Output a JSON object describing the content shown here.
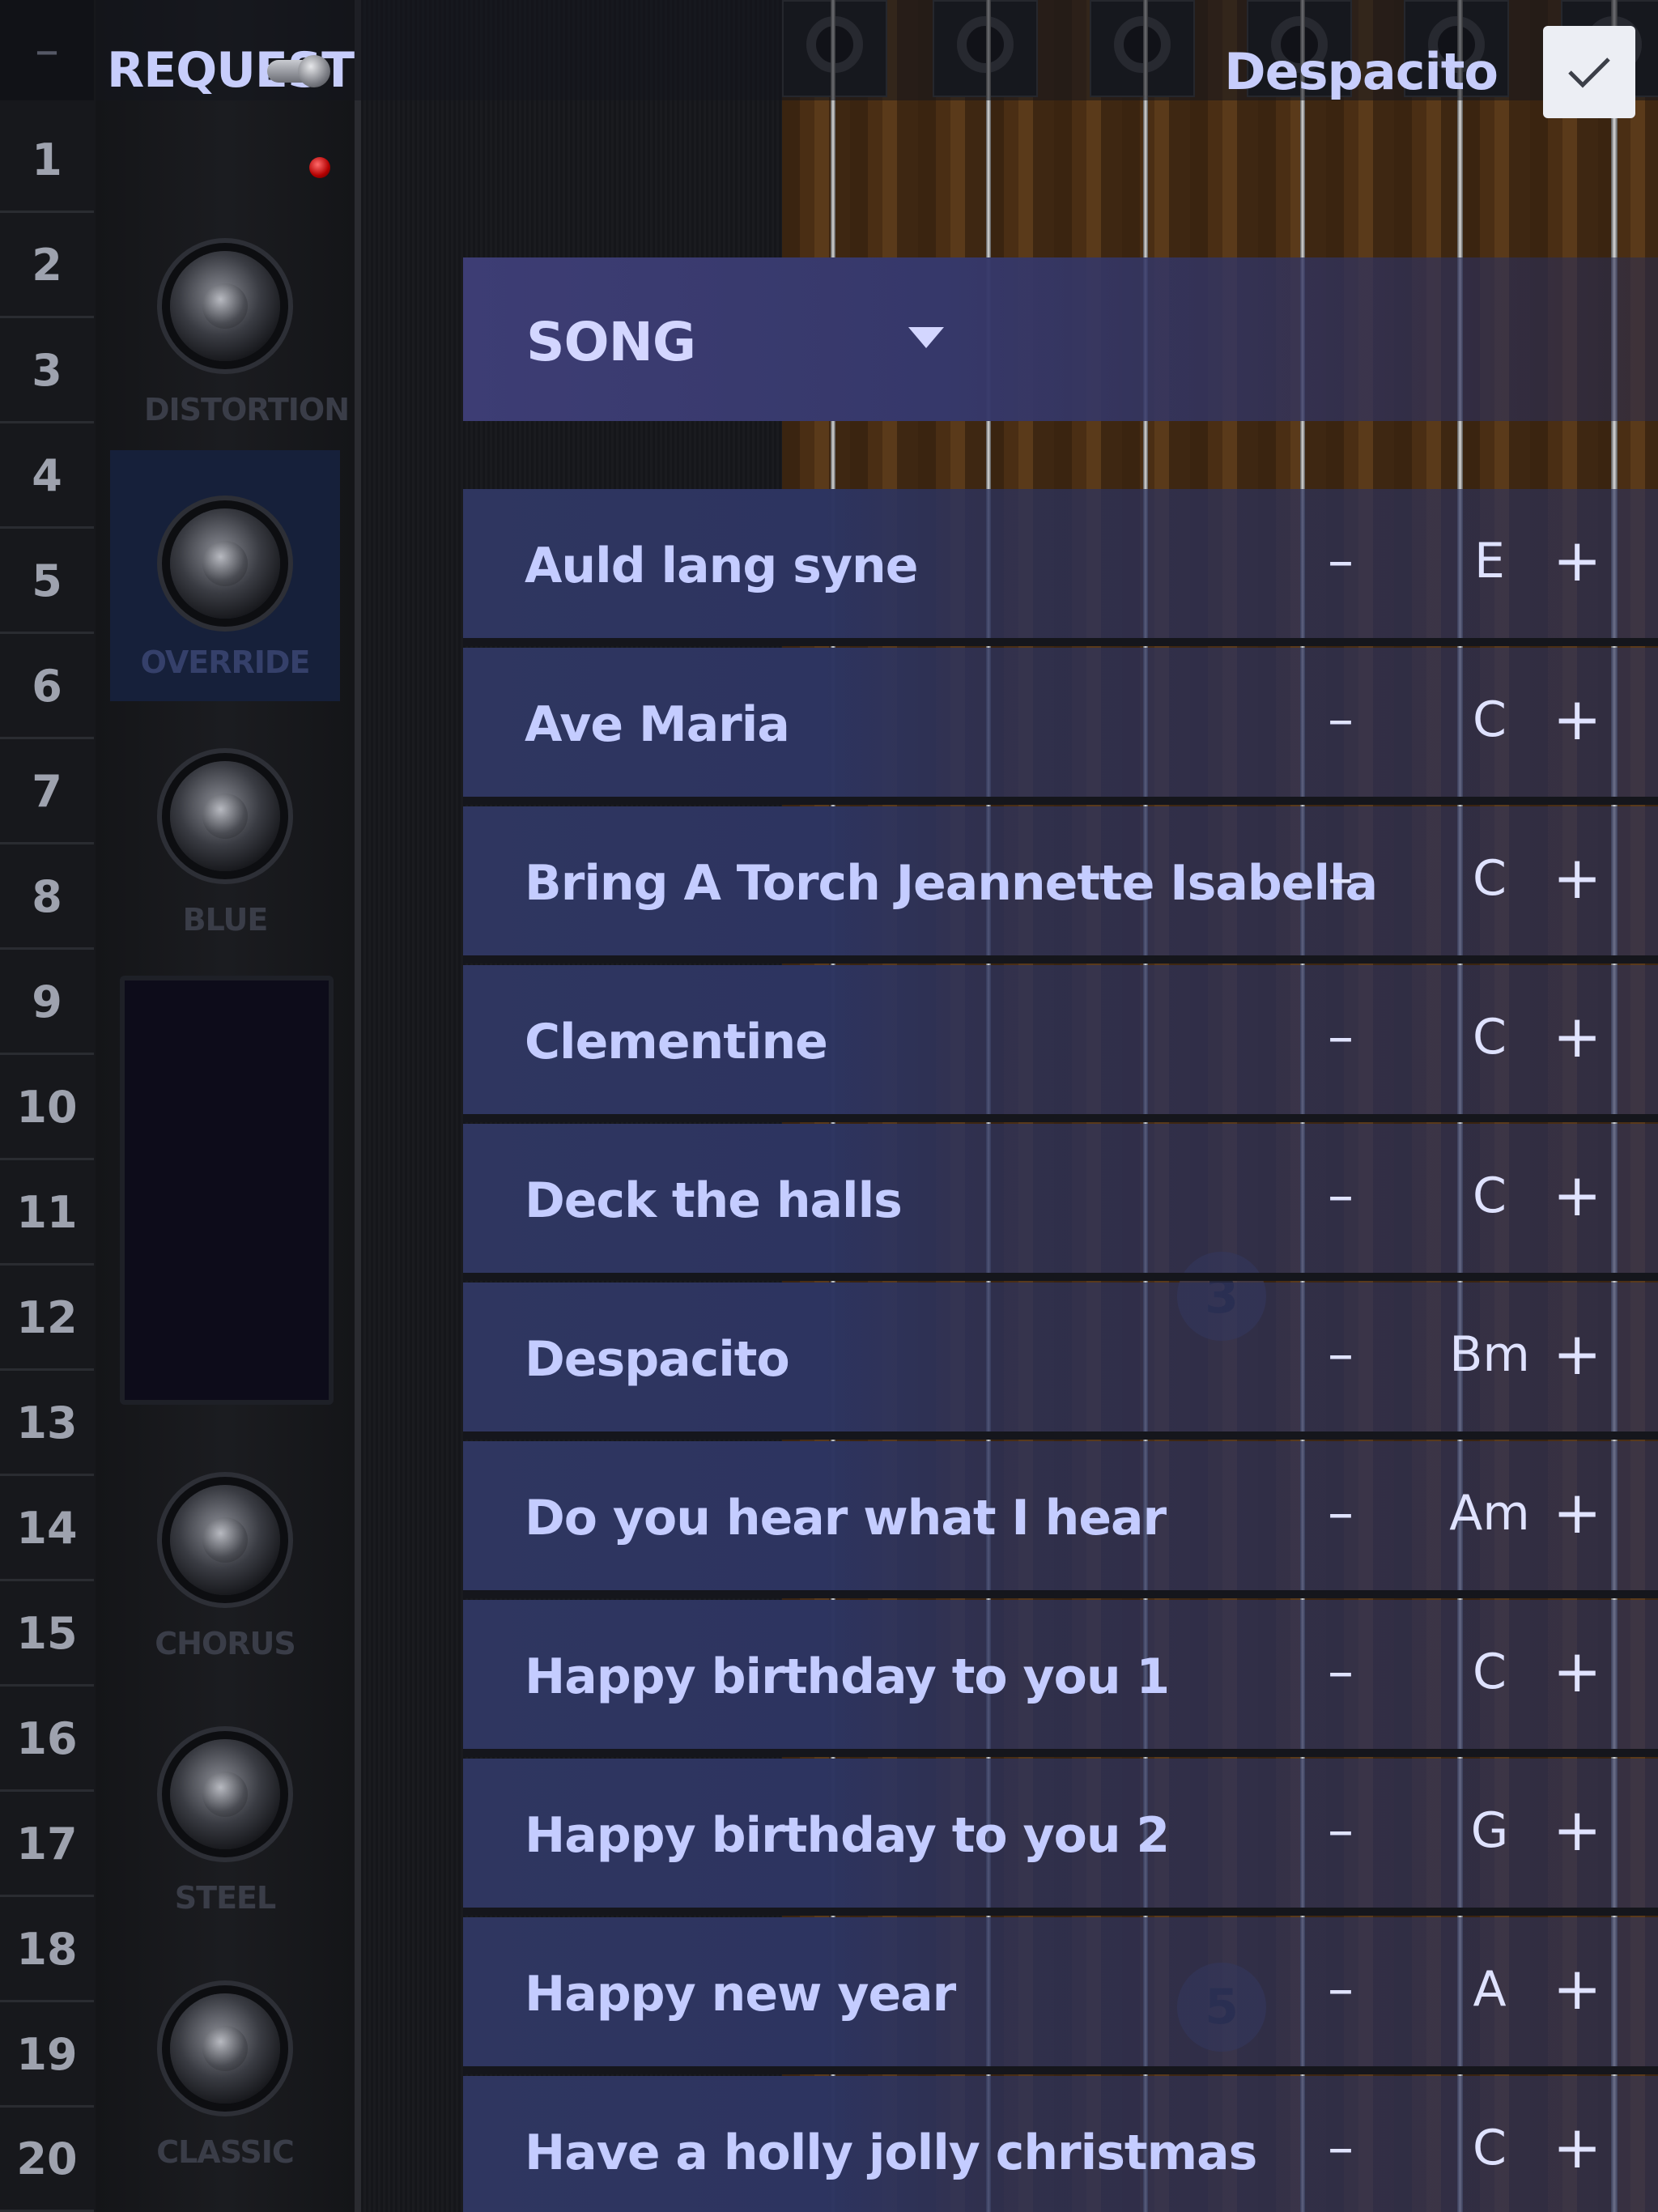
{
  "header": {
    "request_label": "REQUEST",
    "current_song": "Despacito",
    "confirm_icon": "checkmark-icon"
  },
  "fret_numbers": [
    "1",
    "2",
    "3",
    "4",
    "5",
    "6",
    "7",
    "8",
    "9",
    "10",
    "11",
    "12",
    "13",
    "14",
    "15",
    "16",
    "17",
    "18",
    "19",
    "20"
  ],
  "rail_minus": "–",
  "effects": {
    "distortion": "DISTORTION",
    "override": "OVERRIDE",
    "blue": "BLUE",
    "chorus": "CHORUS",
    "steel": "STEEL",
    "classic": "CLASSIC"
  },
  "fret_markers": [
    "3",
    "5"
  ],
  "song_list": {
    "header_label": "SONG",
    "sort_icon": "caret-down-icon",
    "minus_label": "–",
    "plus_label": "+",
    "rows": [
      {
        "title": "Auld lang syne",
        "key": "E"
      },
      {
        "title": "Ave Maria",
        "key": "C"
      },
      {
        "title": "Bring A Torch Jeannette Isabella",
        "key": "C"
      },
      {
        "title": "Clementine",
        "key": "C"
      },
      {
        "title": "Deck the halls",
        "key": "C"
      },
      {
        "title": "Despacito",
        "key": "Bm"
      },
      {
        "title": "Do you hear what I hear",
        "key": "Am"
      },
      {
        "title": "Happy birthday to you 1",
        "key": "C"
      },
      {
        "title": "Happy birthday to you 2",
        "key": "G"
      },
      {
        "title": "Happy new year",
        "key": "A"
      },
      {
        "title": "Have a holly jolly christmas",
        "key": "C"
      }
    ]
  }
}
